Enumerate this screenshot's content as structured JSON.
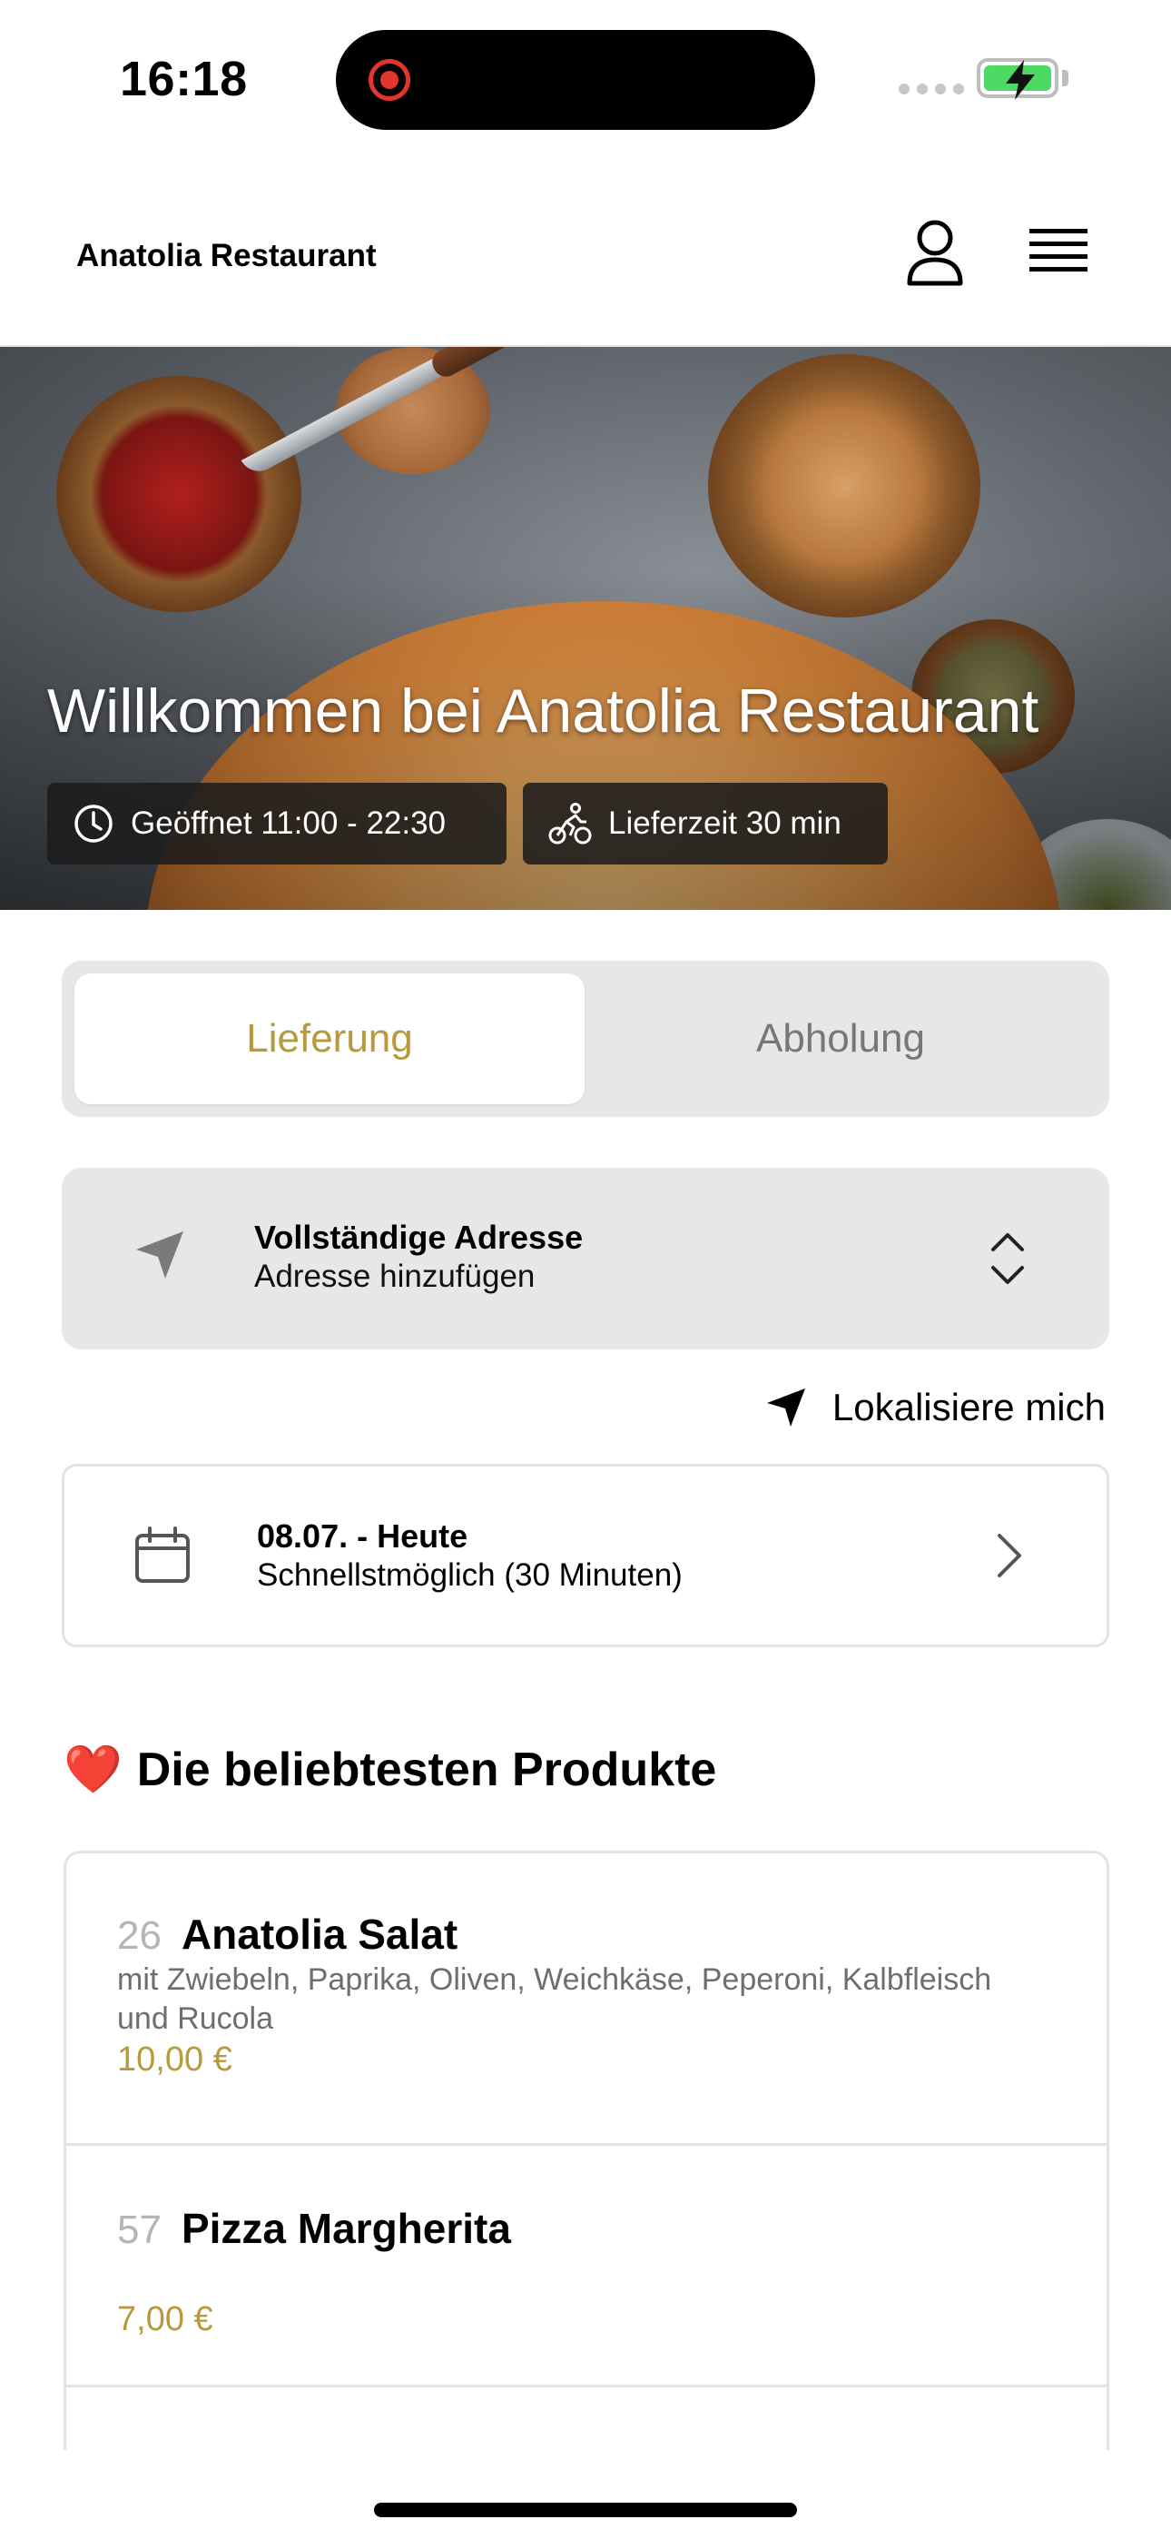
{
  "status_bar": {
    "time": "16:18"
  },
  "header": {
    "brand": "Anatolia Restaurant",
    "icons": [
      "user-icon",
      "menu-icon"
    ]
  },
  "hero": {
    "title": "Willkommen bei Anatolia Restaurant",
    "hours": "Geöffnet 11:00 - 22:30",
    "delivery_time": "Lieferzeit 30 min"
  },
  "order_mode": {
    "options": [
      "Lieferung",
      "Abholung"
    ],
    "selected": "Lieferung",
    "accent": "#b9993d"
  },
  "address": {
    "title": "Vollständige Adresse",
    "subtitle": "Adresse hinzufügen"
  },
  "locate": {
    "label": "Lokalisiere mich"
  },
  "schedule": {
    "title": "08.07. - Heute",
    "subtitle": "Schnellstmöglich (30 Minuten)"
  },
  "popular": {
    "emoji": "❤️",
    "title": "Die beliebtesten Produkte",
    "products": [
      {
        "number": "26",
        "name": "Anatolia Salat",
        "description": "mit Zwiebeln, Paprika, Oliven, Weichkäse, Peperoni, Kalbfleisch und Rucola",
        "price": "10,00 €"
      },
      {
        "number": "57",
        "name": "Pizza Margherita",
        "description": "",
        "price": "7,00 €"
      }
    ]
  }
}
